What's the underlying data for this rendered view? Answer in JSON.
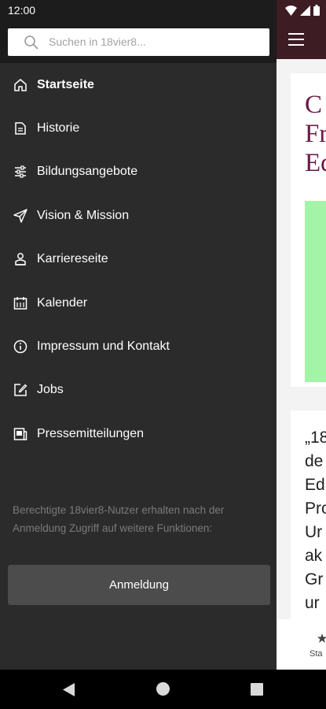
{
  "status_bar": {
    "time": "12:00"
  },
  "search": {
    "placeholder": "Suchen in 18vier8..."
  },
  "menu": {
    "items": [
      {
        "label": "Startseite",
        "icon": "home-icon",
        "active": true
      },
      {
        "label": "Historie",
        "icon": "document-icon"
      },
      {
        "label": "Bildungsangebote",
        "icon": "sliders-icon"
      },
      {
        "label": "Vision & Mission",
        "icon": "send-icon"
      },
      {
        "label": "Karriereseite",
        "icon": "person-icon"
      },
      {
        "label": "Kalender",
        "icon": "calendar-icon"
      },
      {
        "label": "Impressum und Kontakt",
        "icon": "info-icon"
      },
      {
        "label": "Jobs",
        "icon": "edit-icon"
      },
      {
        "label": "Pressemitteilungen",
        "icon": "press-icon"
      }
    ]
  },
  "login_note": "Berechtigte 18vier8-Nutzer erhalten nach der Anmeldung Zugriff auf weitere Funktionen:",
  "login_button": "Anmeldung",
  "background_app": {
    "card1_title_lines": [
      "C",
      "Fr",
      "Ed"
    ],
    "card2_text_lines": [
      "„18",
      "de",
      "Ed",
      "Pro",
      "Ur",
      "ak",
      "Gr",
      "ur"
    ],
    "bottom_label": "Sta"
  },
  "colors": {
    "drawer_bg": "#2b2b2b",
    "status_bar": "#1c1c1c",
    "app_accent": "#3d1c24",
    "title_color": "#6b1a47",
    "green_block": "#a4f4a8"
  }
}
